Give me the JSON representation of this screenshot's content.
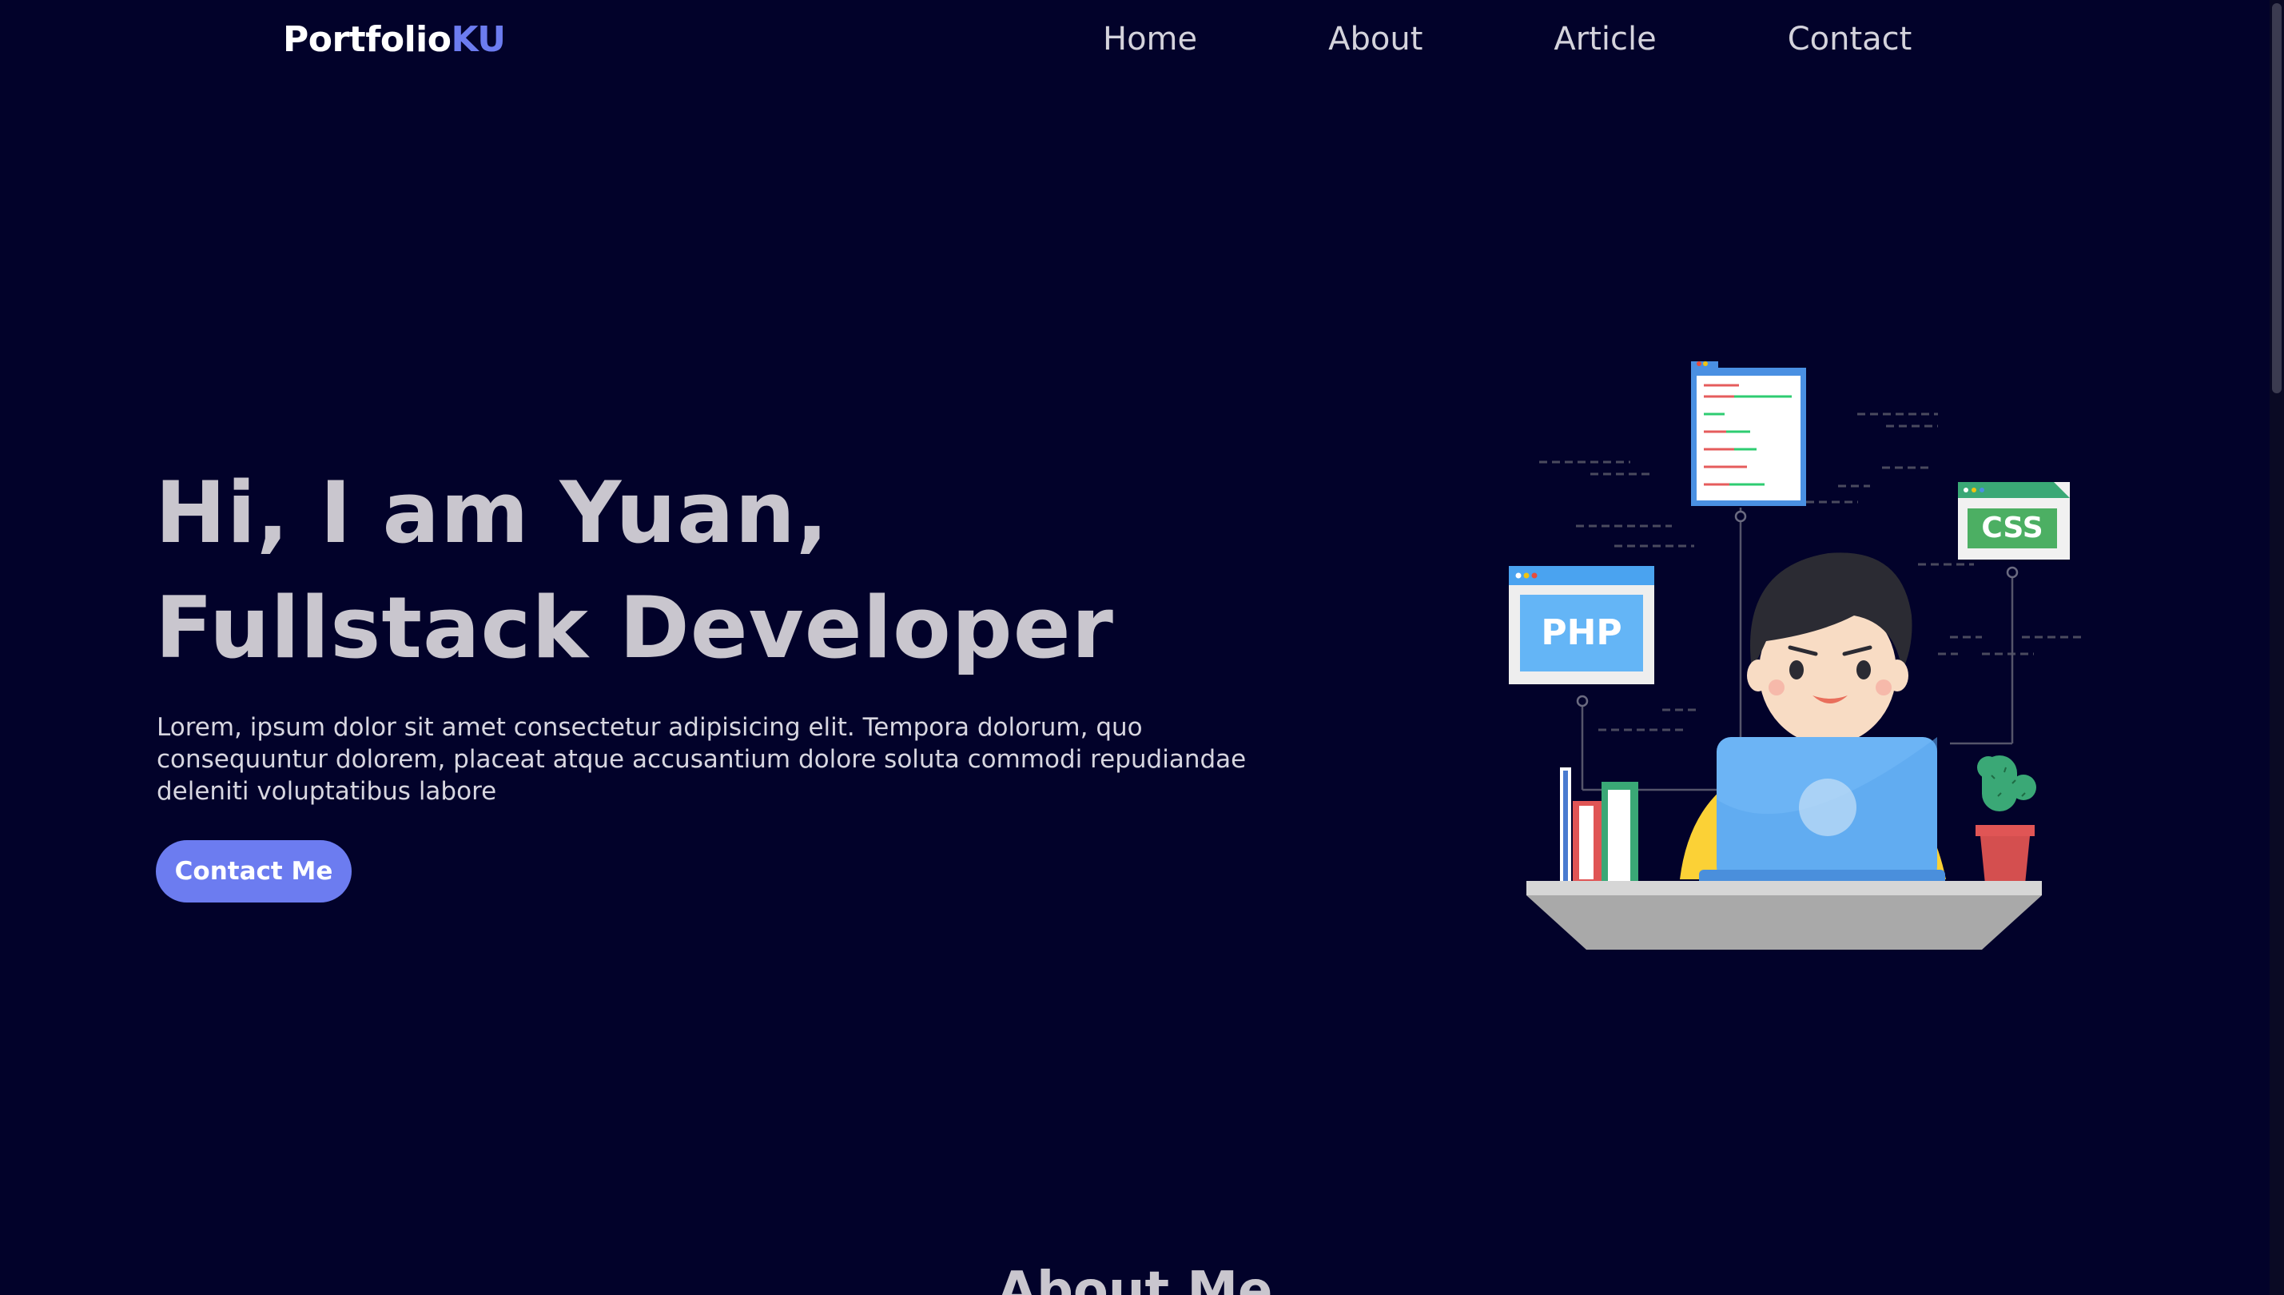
{
  "brand": {
    "name_main": "Portfolio",
    "name_accent": "KU"
  },
  "nav": {
    "items": [
      {
        "label": "Home"
      },
      {
        "label": "About"
      },
      {
        "label": "Article"
      },
      {
        "label": "Contact"
      }
    ]
  },
  "hero": {
    "title_line1": "Hi, I am Yuan,",
    "title_line2": "Fullstack Developer",
    "description": "Lorem, ipsum dolor sit amet consectetur adipisicing elit. Tempora dolorum, quo consequuntur dolorem, placeat atque accusantium dolore soluta commodi repudiandae deleniti voluptatibus labore",
    "cta_label": "Contact Me"
  },
  "illustration": {
    "php_label": "PHP",
    "css_label": "CSS"
  },
  "about": {
    "title": "About Me"
  },
  "colors": {
    "background": "#02022a",
    "accent": "#6c7cf0",
    "heading": "#c9c6ce"
  }
}
